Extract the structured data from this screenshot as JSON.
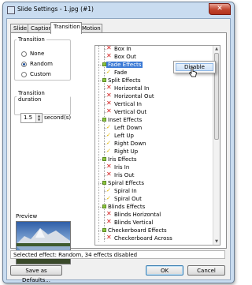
{
  "window": {
    "title": "Slide Settings - 1.jpg (#1)",
    "close_glyph": "✕"
  },
  "tabs": [
    {
      "label": "Slide",
      "active": false
    },
    {
      "label": "Caption",
      "active": false
    },
    {
      "label": "Transition",
      "active": true
    },
    {
      "label": "Motion",
      "active": false
    }
  ],
  "transition": {
    "group_label": "Transition",
    "options": [
      {
        "label": "None",
        "selected": false
      },
      {
        "label": "Random",
        "selected": true
      },
      {
        "label": "Custom",
        "selected": false
      }
    ]
  },
  "duration": {
    "group_label": "Transition duration",
    "value": "1.5",
    "unit": "second(s)"
  },
  "preview": {
    "label": "Preview"
  },
  "effects_tree": [
    {
      "type": "item",
      "label": "Box In",
      "disabled": true
    },
    {
      "type": "item",
      "label": "Box Out",
      "disabled": true
    },
    {
      "type": "group",
      "label": "Fade Effects",
      "selected": true
    },
    {
      "type": "item",
      "label": "Fade",
      "disabled": false
    },
    {
      "type": "group",
      "label": "Split Effects"
    },
    {
      "type": "item",
      "label": "Horizontal In",
      "disabled": true
    },
    {
      "type": "item",
      "label": "Horizontal Out",
      "disabled": true
    },
    {
      "type": "item",
      "label": "Vertical In",
      "disabled": true
    },
    {
      "type": "item",
      "label": "Vertical Out",
      "disabled": true
    },
    {
      "type": "group",
      "label": "Inset Effects"
    },
    {
      "type": "item",
      "label": "Left Down",
      "disabled": false
    },
    {
      "type": "item",
      "label": "Left Up",
      "disabled": false
    },
    {
      "type": "item",
      "label": "Right Down",
      "disabled": false
    },
    {
      "type": "item",
      "label": "Right Up",
      "disabled": false
    },
    {
      "type": "group",
      "label": "Iris Effects"
    },
    {
      "type": "item",
      "label": "Iris In",
      "disabled": true
    },
    {
      "type": "item",
      "label": "Iris Out",
      "disabled": true
    },
    {
      "type": "group",
      "label": "Spiral Effects"
    },
    {
      "type": "item",
      "label": "Spiral In",
      "disabled": false
    },
    {
      "type": "item",
      "label": "Spiral Out",
      "disabled": false
    },
    {
      "type": "group",
      "label": "Blinds Effects"
    },
    {
      "type": "item",
      "label": "Blinds Horizontal",
      "disabled": true
    },
    {
      "type": "item",
      "label": "Blinds Vertical",
      "disabled": true
    },
    {
      "type": "group",
      "label": "Checkerboard Effects"
    },
    {
      "type": "item",
      "label": "Checkerboard Across",
      "disabled": true
    }
  ],
  "context_menu": {
    "items": [
      "Disable"
    ]
  },
  "status_text": "Selected effect: Random, 34 effects disabled",
  "buttons": {
    "save_defaults": "Save as Defaults...",
    "ok": "OK",
    "cancel": "Cancel"
  }
}
